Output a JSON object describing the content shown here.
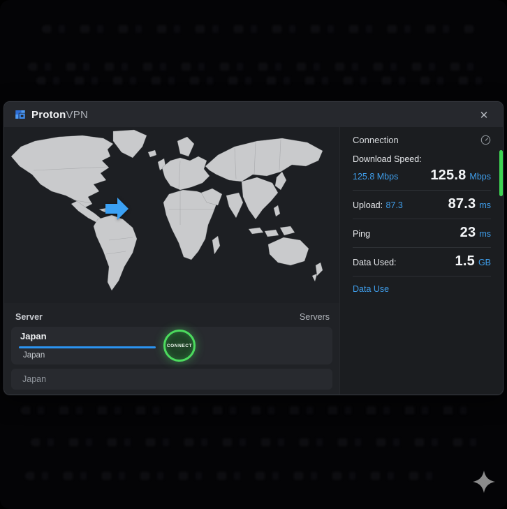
{
  "titlebar": {
    "brand_primary": "Proton",
    "brand_secondary": "VPN",
    "close_glyph": "✕"
  },
  "connection": {
    "header": "Connection",
    "download": {
      "label": "Download Speed:",
      "inline_value": "125.8 Mbps",
      "value": "125.8",
      "unit": "Mbps"
    },
    "upload": {
      "label": "Upload:",
      "inline_value": "87.3",
      "value": "87.3",
      "unit": "ms"
    },
    "ping": {
      "label": "Ping",
      "value": "23",
      "unit": "ms"
    },
    "data_used": {
      "label": "Data Used:",
      "value": "1.5",
      "unit": "GB"
    },
    "link": "Data Use"
  },
  "server_panel": {
    "label": "Server",
    "servers_link": "Servers",
    "input_value": "Japan",
    "suggestion": "Japan",
    "option": "Japan",
    "connect_label": "CONNECT"
  },
  "colors": {
    "accent_blue": "#3f9eeb",
    "input_underline_blue": "#2b93f0",
    "accent_green": "#45d95b",
    "map_land": "#c9cacc"
  }
}
